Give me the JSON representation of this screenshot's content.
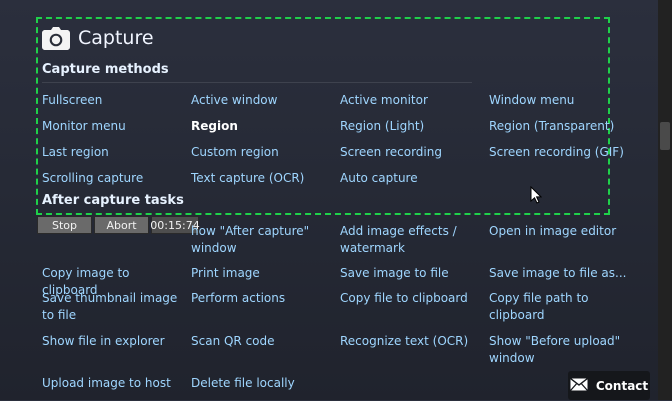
{
  "header": {
    "title": "Capture"
  },
  "sections": {
    "capture_methods": {
      "title": "Capture methods",
      "rows": [
        [
          "Fullscreen",
          "Active window",
          "Active monitor",
          "Window menu"
        ],
        [
          "Monitor menu",
          "Region",
          "Region (Light)",
          "Region (Transparent)"
        ],
        [
          "Last region",
          "Custom region",
          "Screen recording",
          "Screen recording (GIF)"
        ],
        [
          "Scrolling capture",
          "Text capture (OCR)",
          "Auto capture",
          ""
        ]
      ],
      "selected": "Region"
    },
    "after_capture_tasks": {
      "title": "After capture tasks",
      "rows": [
        [
          "",
          "how \"After capture\" window",
          "Add image effects / watermark",
          "Open in image editor"
        ],
        [
          "Copy image to clipboard",
          "Print image",
          "Save image to file",
          "Save image to file as..."
        ],
        [
          "Save thumbnail image to file",
          "Perform actions",
          "Copy file to clipboard",
          "Copy file path to clipboard"
        ],
        [
          "Show file in explorer",
          "Scan QR code",
          "Recognize text (OCR)",
          "Show \"Before upload\" window"
        ],
        [
          "Upload image to host",
          "Delete file locally",
          "",
          ""
        ]
      ]
    }
  },
  "recording_controls": {
    "stop": "Stop",
    "abort": "Abort",
    "timer": "00:15:74"
  },
  "contact": {
    "label": "Contact"
  },
  "icons": {
    "camera": "camera-icon",
    "contact": "envelope-icon",
    "cursor": "mouse-pointer-icon"
  },
  "colors": {
    "accent_text": "#9fd6ff",
    "dashed_border": "#1fd14a",
    "selected_text": "#ffffff"
  }
}
